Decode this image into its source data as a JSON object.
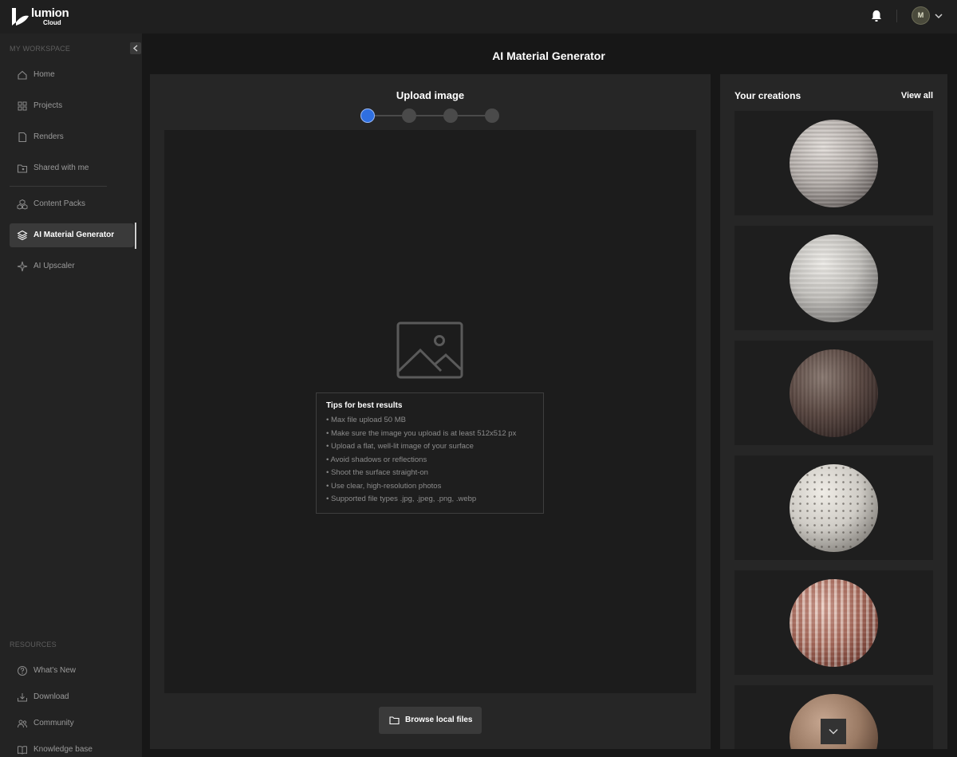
{
  "app": {
    "logo_name": "lumion",
    "logo_sub": "Cloud",
    "user_initial": "M"
  },
  "sidebar": {
    "workspace_label": "MY WORKSPACE",
    "resources_label": "RESOURCES",
    "workspace_items": [
      {
        "label": "Home",
        "icon": "home-icon"
      },
      {
        "label": "Projects",
        "icon": "grid-icon"
      },
      {
        "label": "Renders",
        "icon": "file-icon"
      },
      {
        "label": "Shared with me",
        "icon": "shared-folder-icon"
      }
    ],
    "tool_items": [
      {
        "label": "Content Packs",
        "icon": "cubes-icon"
      },
      {
        "label": "AI Material Generator",
        "icon": "layers-icon",
        "active": true
      },
      {
        "label": "AI Upscaler",
        "icon": "sparkle-icon"
      }
    ],
    "resource_items": [
      {
        "label": "What's New",
        "icon": "question-icon"
      },
      {
        "label": "Download",
        "icon": "download-icon"
      },
      {
        "label": "Community",
        "icon": "people-icon"
      },
      {
        "label": "Knowledge base",
        "icon": "book-icon"
      }
    ]
  },
  "main": {
    "page_title": "AI Material Generator",
    "upload_title": "Upload image",
    "steps_total": 4,
    "step_current": 1,
    "tips_title": "Tips for best results",
    "tips": [
      "• Max file upload 50 MB",
      "• Make sure the image you upload is at least 512x512 px",
      "• Upload a flat, well-lit image of your surface",
      "• Avoid shadows or reflections",
      "• Shoot the surface straight-on",
      "• Use clear, high-resolution photos",
      "• Supported file types .jpg, .jpeg, .png, .webp"
    ],
    "browse_label": "Browse local files"
  },
  "creations": {
    "title": "Your creations",
    "view_all": "View all",
    "materials": [
      {
        "kind": "light-wood-striped",
        "color": "#b4aeaa"
      },
      {
        "kind": "pale-wood",
        "color": "#c2c0bc"
      },
      {
        "kind": "dark-wood",
        "color": "#5a4842"
      },
      {
        "kind": "perforated-white",
        "color": "#cfccc6"
      },
      {
        "kind": "red-knit",
        "color": "#b07e6e"
      },
      {
        "kind": "terracotta-sand",
        "color": "#9a7a64"
      }
    ]
  },
  "colors": {
    "accent": "#2f6fe0",
    "background": "#171717",
    "panel": "#262626",
    "sidebar": "#232323"
  }
}
